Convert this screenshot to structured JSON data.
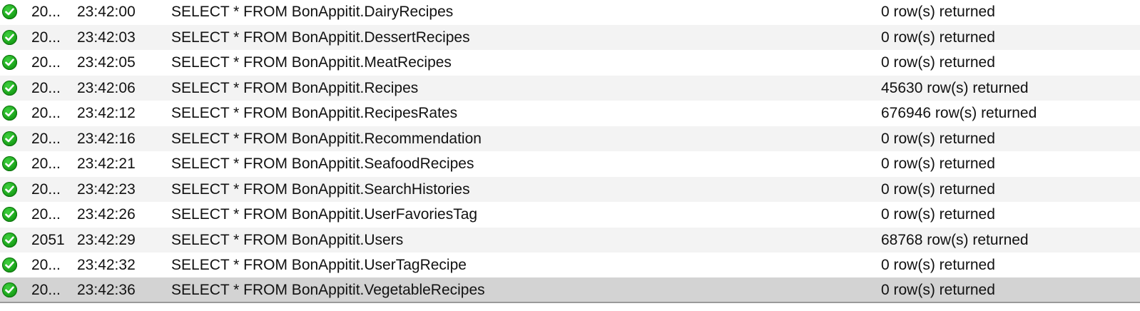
{
  "output_log": {
    "rows": [
      {
        "num": "20...",
        "time": "23:42:00",
        "action": "SELECT * FROM BonAppitit.DairyRecipes",
        "message": "0 row(s) returned",
        "status_icon": "success-check-icon"
      },
      {
        "num": "20...",
        "time": "23:42:03",
        "action": "SELECT * FROM BonAppitit.DessertRecipes",
        "message": "0 row(s) returned",
        "status_icon": "success-check-icon"
      },
      {
        "num": "20...",
        "time": "23:42:05",
        "action": "SELECT * FROM BonAppitit.MeatRecipes",
        "message": "0 row(s) returned",
        "status_icon": "success-check-icon"
      },
      {
        "num": "20...",
        "time": "23:42:06",
        "action": "SELECT * FROM BonAppitit.Recipes",
        "message": "45630 row(s) returned",
        "status_icon": "success-check-icon"
      },
      {
        "num": "20...",
        "time": "23:42:12",
        "action": "SELECT * FROM BonAppitit.RecipesRates",
        "message": "676946 row(s) returned",
        "status_icon": "success-check-icon"
      },
      {
        "num": "20...",
        "time": "23:42:16",
        "action": "SELECT * FROM BonAppitit.Recommendation",
        "message": "0 row(s) returned",
        "status_icon": "success-check-icon"
      },
      {
        "num": "20...",
        "time": "23:42:21",
        "action": "SELECT * FROM BonAppitit.SeafoodRecipes",
        "message": "0 row(s) returned",
        "status_icon": "success-check-icon"
      },
      {
        "num": "20...",
        "time": "23:42:23",
        "action": "SELECT * FROM BonAppitit.SearchHistories",
        "message": "0 row(s) returned",
        "status_icon": "success-check-icon"
      },
      {
        "num": "20...",
        "time": "23:42:26",
        "action": "SELECT * FROM BonAppitit.UserFavoriesTag",
        "message": "0 row(s) returned",
        "status_icon": "success-check-icon"
      },
      {
        "num": "2051",
        "time": "23:42:29",
        "action": "SELECT * FROM BonAppitit.Users",
        "message": "68768 row(s) returned",
        "status_icon": "success-check-icon"
      },
      {
        "num": "20...",
        "time": "23:42:32",
        "action": "SELECT * FROM BonAppitit.UserTagRecipe",
        "message": "0 row(s) returned",
        "status_icon": "success-check-icon"
      },
      {
        "num": "20...",
        "time": "23:42:36",
        "action": "SELECT * FROM BonAppitit.VegetableRecipes",
        "message": "0 row(s) returned",
        "status_icon": "success-check-icon",
        "selected": true
      }
    ],
    "colors": {
      "success": "#1aa31a",
      "row_alt": "#f3f3f3",
      "row_selected": "#d3d3d3"
    }
  }
}
